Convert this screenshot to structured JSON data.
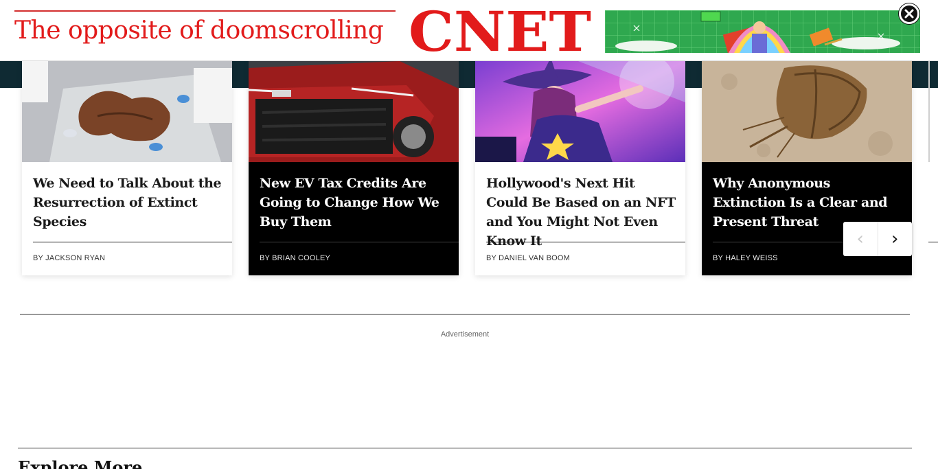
{
  "ad_banner": {
    "slogan": "The opposite of doomscrolling",
    "logo_text": "CNET",
    "close_icon": "close-icon",
    "colors": {
      "brand_red": "#e21b1b",
      "art_green": "#2fa84f"
    }
  },
  "carousel": {
    "cards": [
      {
        "title": "We Need to Talk About the Resurrection of Extinct Species",
        "byline": "BY JACKSON RYAN",
        "theme": "light"
      },
      {
        "title": "New EV Tax Credits Are Going to Change How We Buy Them",
        "byline": "BY BRIAN COOLEY",
        "theme": "dark"
      },
      {
        "title": "Hollywood's Next Hit Could Be Based on an NFT and You Might Not Even Know It",
        "byline": "BY DANIEL VAN BOOM",
        "theme": "light"
      },
      {
        "title": "Why Anonymous Extinction Is a Clear and Present Threat",
        "byline": "BY HALEY WEISS",
        "theme": "dark"
      }
    ],
    "nav": {
      "prev_icon": "‹",
      "next_icon": "›"
    }
  },
  "advertisement_label": "Advertisement",
  "explore": {
    "title": "Explore More"
  }
}
